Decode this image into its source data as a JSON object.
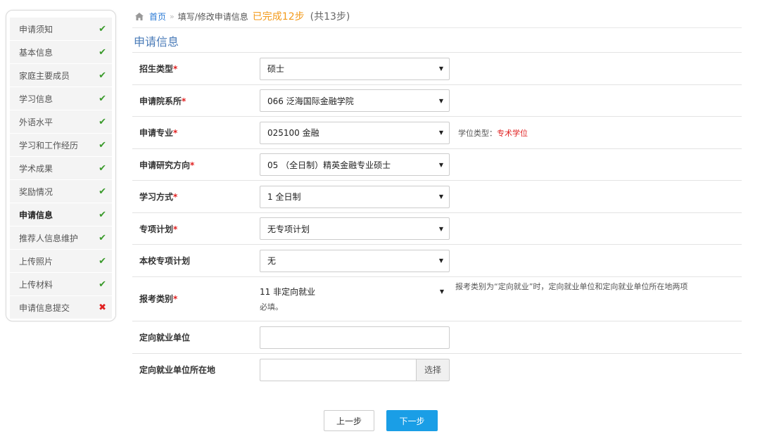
{
  "sidebar": {
    "items": [
      {
        "label": "申请须知",
        "status": "done"
      },
      {
        "label": "基本信息",
        "status": "done"
      },
      {
        "label": "家庭主要成员",
        "status": "done"
      },
      {
        "label": "学习信息",
        "status": "done"
      },
      {
        "label": "外语水平",
        "status": "done"
      },
      {
        "label": "学习和工作经历",
        "status": "done"
      },
      {
        "label": "学术成果",
        "status": "done"
      },
      {
        "label": "奖励情况",
        "status": "done"
      },
      {
        "label": "申请信息",
        "status": "done",
        "active": true
      },
      {
        "label": "推荐人信息维护",
        "status": "done"
      },
      {
        "label": "上传照片",
        "status": "done"
      },
      {
        "label": "上传材料",
        "status": "done"
      },
      {
        "label": "申请信息提交",
        "status": "incomplete"
      }
    ],
    "done_mark": "✔",
    "incomplete_mark": "✖"
  },
  "breadcrumb": {
    "home": "首页",
    "separator": "»",
    "current": "填写/修改申请信息",
    "progress": "已完成12步",
    "total": "(共13步)"
  },
  "section_title": "申请信息",
  "form": {
    "recruit_type": {
      "label": "招生类型",
      "value": "硕士"
    },
    "department": {
      "label": "申请院系所",
      "value": "066 泛海国际金融学院"
    },
    "major": {
      "label": "申请专业",
      "value": "025100 金融",
      "degree_label": "学位类型：",
      "degree_value": "专术学位"
    },
    "direction": {
      "label": "申请研究方向",
      "value": "05 （全日制）精英金融专业硕士"
    },
    "study_mode": {
      "label": "学习方式",
      "value": "1 全日制"
    },
    "special_plan": {
      "label": "专项计划",
      "value": "无专项计划"
    },
    "school_plan": {
      "label": "本校专项计划",
      "value": "无"
    },
    "exam_category": {
      "label": "报考类别",
      "value": "11 非定向就业",
      "note_line1": "报考类别为“定向就业”时，定向就业单位和定向就业单位所在地两项",
      "note_line2": "必填。"
    },
    "employer": {
      "label": "定向就业单位",
      "value": ""
    },
    "employer_location": {
      "label": "定向就业单位所在地",
      "value": "",
      "button": "选择"
    },
    "required_mark": "*"
  },
  "buttons": {
    "prev": "上一步",
    "next": "下一步"
  },
  "colors": {
    "accent": "#1a9ee6",
    "link": "#2b7bd6",
    "progress": "#f39a1a",
    "required": "#e02020",
    "done": "#3a9a2b"
  }
}
